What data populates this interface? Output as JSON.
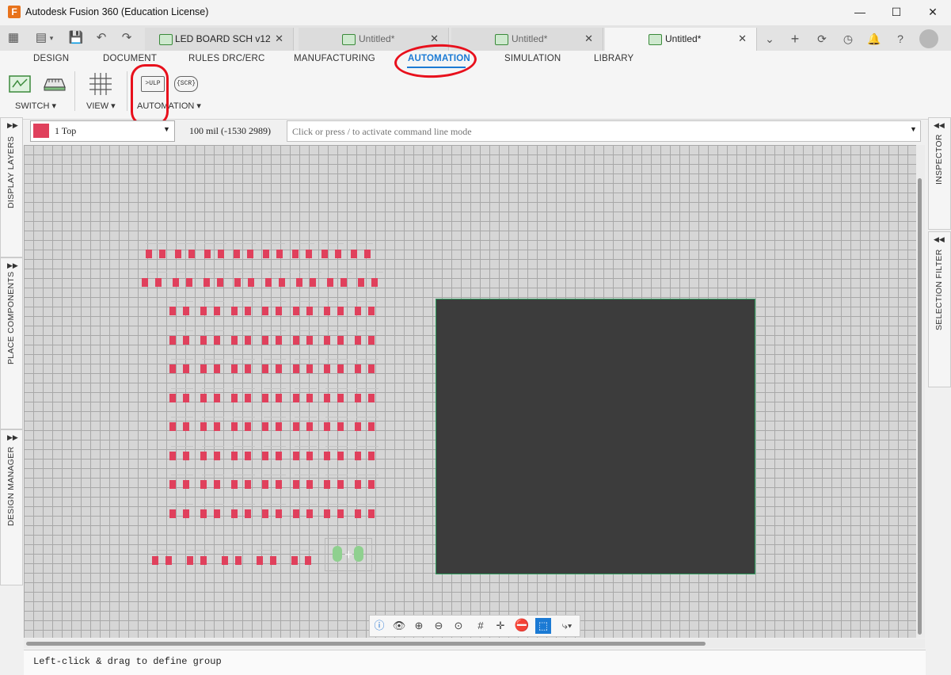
{
  "window": {
    "title": "Autodesk Fusion 360 (Education License)",
    "app_icon_letter": "F"
  },
  "tabs": [
    {
      "label": "LED BOARD SCH v12"
    },
    {
      "label": "Untitled*"
    },
    {
      "label": "Untitled*"
    },
    {
      "label": "Untitled*"
    }
  ],
  "ribbon": {
    "tabs": [
      "DESIGN",
      "DOCUMENT",
      "RULES DRC/ERC",
      "MANUFACTURING",
      "AUTOMATION",
      "SIMULATION",
      "LIBRARY"
    ],
    "active_tab": "AUTOMATION",
    "groups": {
      "switch": "SWITCH ▾",
      "view": "VIEW ▾",
      "automation": "AUTOMATION ▾"
    },
    "ulp_label": ">ULP",
    "scr_label": "{SCR}"
  },
  "toolbar": {
    "layer": "1 Top",
    "layer_color": "#e0405c",
    "coords": "100 mil (-1530 2989)",
    "command_placeholder": "Click or press / to activate command line mode"
  },
  "side_panels": {
    "left": [
      "DISPLAY LAYERS",
      "PLACE COMPONENTS",
      "DESIGN MANAGER"
    ],
    "right": [
      "INSPECTOR",
      "SELECTION FILTER"
    ]
  },
  "canvas": {
    "board_outline_color": "#3c3c3c",
    "pad_color": "#e0405c",
    "led_rows": 10,
    "led_cols": 7
  },
  "status": {
    "text": "Left-click & drag to define group"
  }
}
